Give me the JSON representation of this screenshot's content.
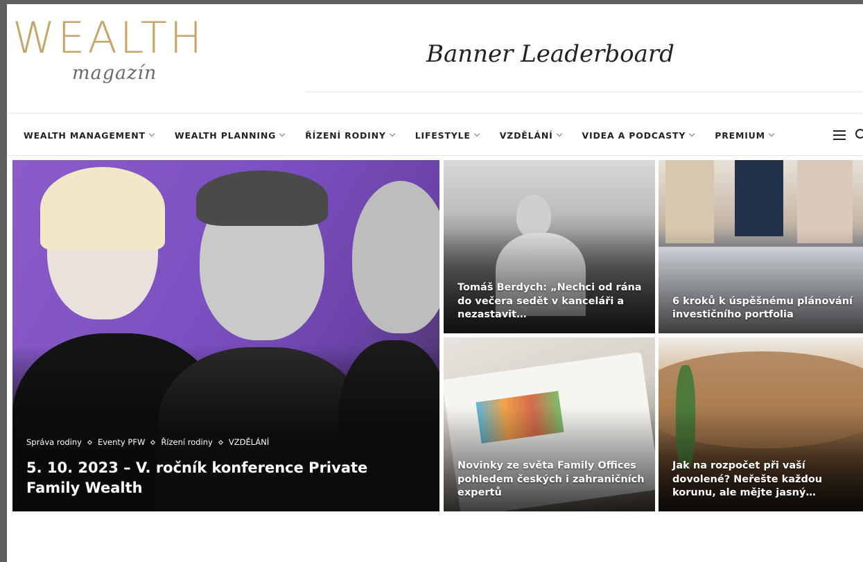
{
  "logo": {
    "main": "WEALTH",
    "sub": "magazín"
  },
  "banner": {
    "text": "Banner Leaderboard"
  },
  "nav": {
    "items": [
      {
        "label": "WEALTH MANAGEMENT"
      },
      {
        "label": "WEALTH PLANNING"
      },
      {
        "label": "ŘÍZENÍ RODINY"
      },
      {
        "label": "LIFESTYLE"
      },
      {
        "label": "VZDĚLÁNÍ"
      },
      {
        "label": "VIDEA A PODCASTY"
      },
      {
        "label": "PREMIUM"
      }
    ],
    "icons": {
      "menu": "hamburger-icon",
      "search": "search-icon"
    }
  },
  "featured": {
    "tags": [
      "Správa rodiny",
      "Eventy PFW",
      "Řízení rodiny",
      "VZDĚLÁNÍ"
    ],
    "title": "5. 10. 2023 – V. ročník konference Private Family Wealth"
  },
  "articles": [
    {
      "title": "Tomáš Berdych: „Nechci od rána do večera sedět v kanceláři a nezastavit…"
    },
    {
      "title": "6 kroků k úspěšnému plánování investičního portfolia"
    },
    {
      "title": "Novinky ze světa Family Offices pohledem českých i zahraničních expertů"
    },
    {
      "title": "Jak na rozpočet při vaší dovolené? Neřešte každou korunu, ale mějte jasný…"
    }
  ],
  "colors": {
    "logo_gold": "#c6a46b",
    "featured_purple": "#8b5cc9"
  }
}
